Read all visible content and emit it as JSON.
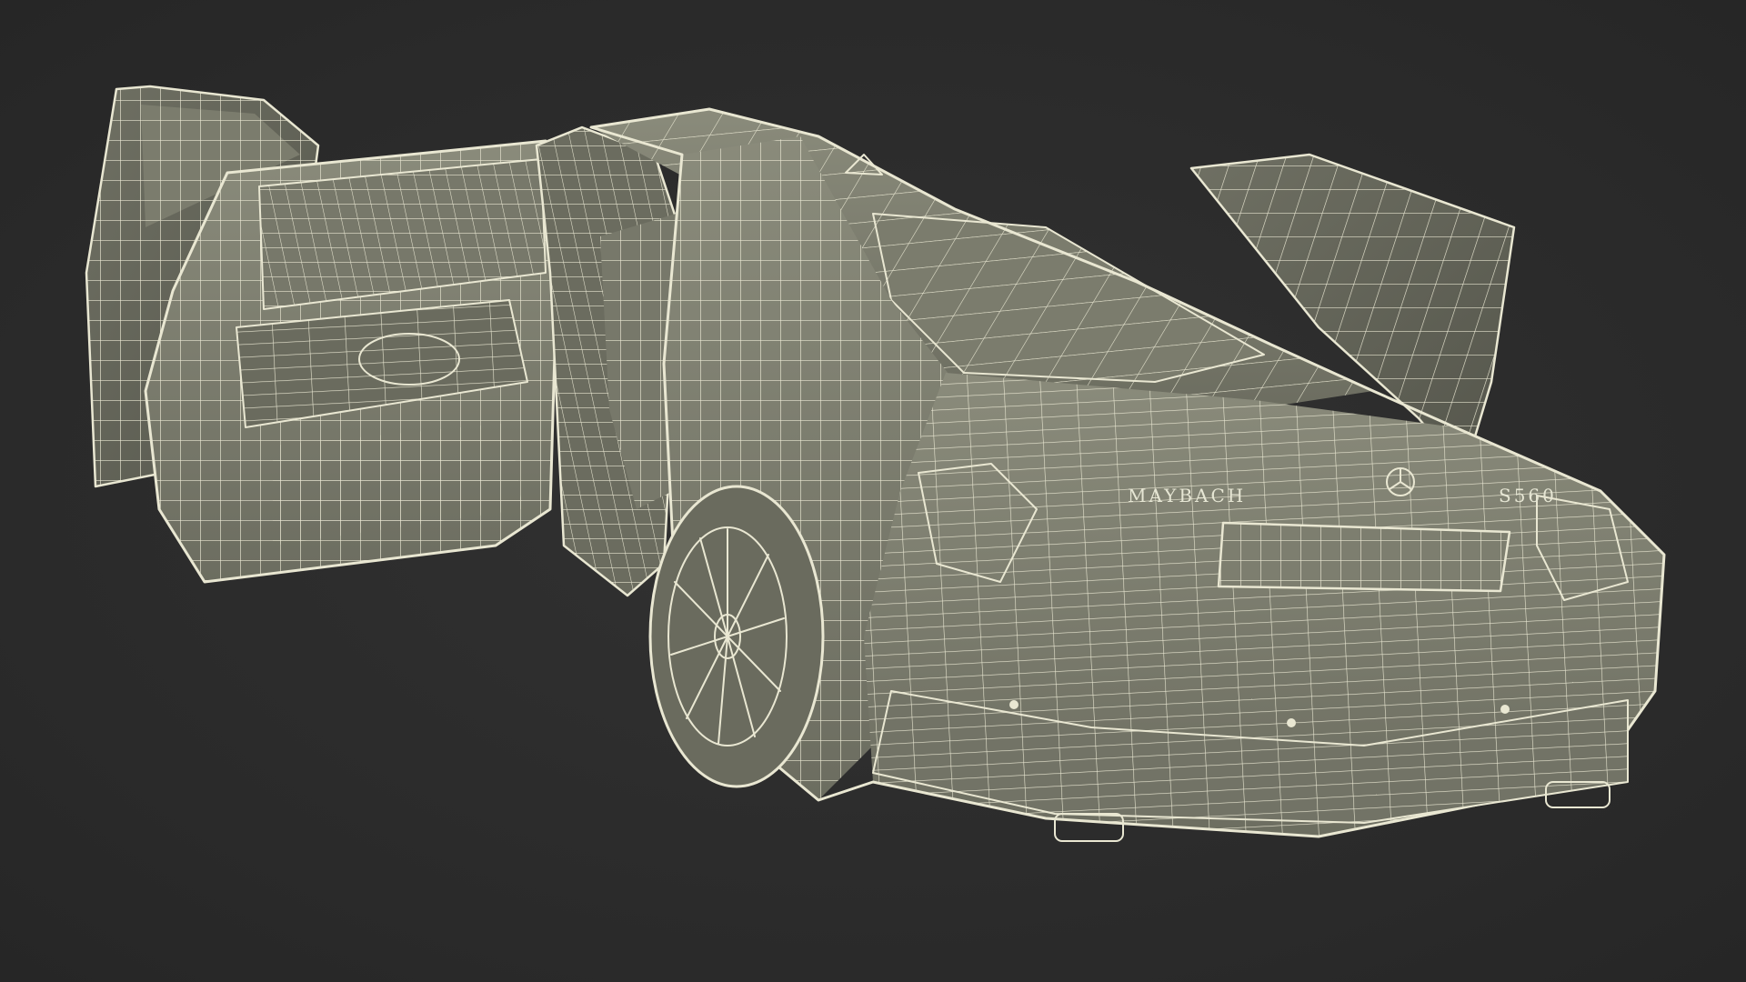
{
  "scene": {
    "background_color": "#2b2b2b",
    "surface_color": "#7e7f70",
    "surface_shadow_color": "#5f6055",
    "wire_color": "#e9e7d2"
  },
  "car": {
    "brand_badge": "MAYBACH",
    "model_badge": "S560",
    "emblem": "three-pointed-star-emblem"
  }
}
